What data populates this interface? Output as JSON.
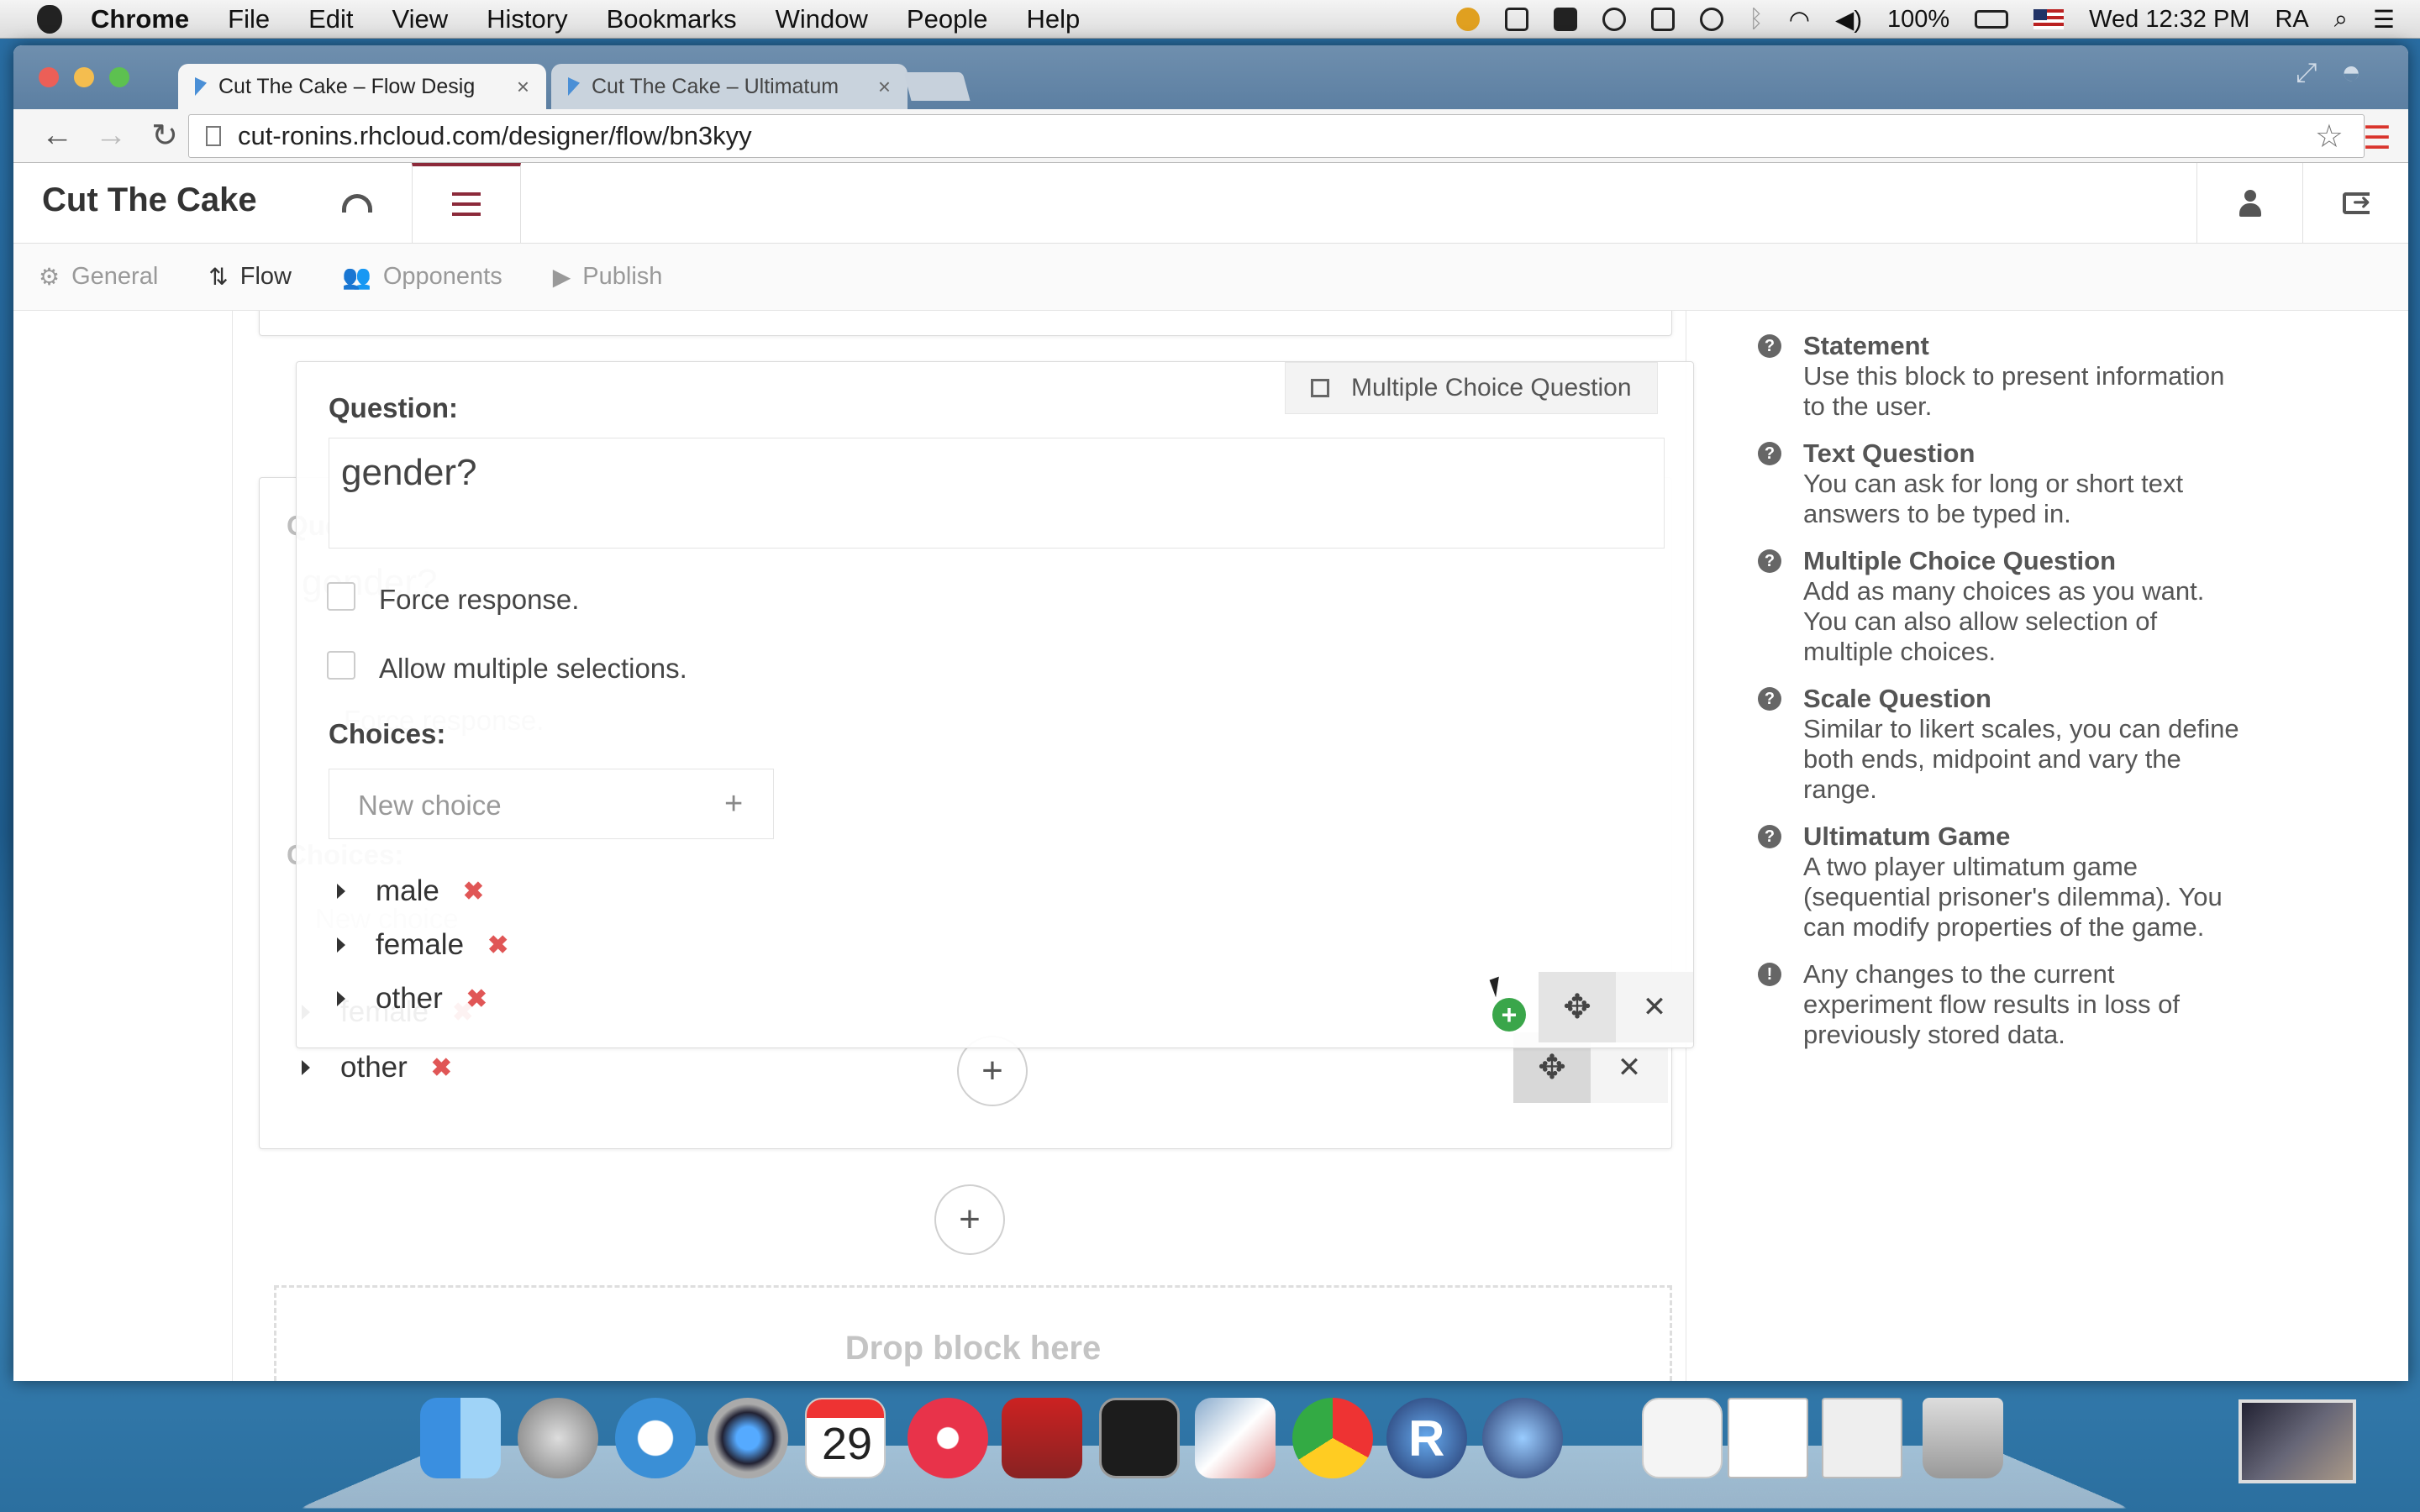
{
  "menubar": {
    "app": "Chrome",
    "items": [
      "File",
      "Edit",
      "View",
      "History",
      "Bookmarks",
      "Window",
      "People",
      "Help"
    ],
    "battery": "100%",
    "clock": "Wed 12:32 PM",
    "user": "RA"
  },
  "browser": {
    "tabs": [
      {
        "title": "Cut The Cake – Flow Desig",
        "close": "×"
      },
      {
        "title": "Cut The Cake – Ultimatum",
        "close": "×"
      }
    ],
    "url": "cut-ronins.rhcloud.com/designer/flow/bn3kyy"
  },
  "app": {
    "brand": "Cut The Cake",
    "subnav": [
      {
        "icon": "gears-icon",
        "label": "General"
      },
      {
        "icon": "sort-icon",
        "label": "Flow"
      },
      {
        "icon": "users-icon",
        "label": "Opponents"
      },
      {
        "icon": "play-icon",
        "label": "Publish"
      }
    ]
  },
  "block": {
    "type_label": "Multiple Choice Question",
    "question_label": "Question:",
    "question_value": "gender?",
    "force_response": "Force response.",
    "allow_multiple": "Allow multiple selections.",
    "choices_label": "Choices:",
    "new_choice_placeholder": "New choice",
    "choices": [
      "male",
      "female",
      "other"
    ]
  },
  "drop_zone": "Drop block here",
  "help": [
    {
      "title": "Statement",
      "desc": "Use this block to present information to the user."
    },
    {
      "title": "Text Question",
      "desc": "You can ask for long or short text answers to be typed in."
    },
    {
      "title": "Multiple Choice Question",
      "desc": "Add as many choices as you want. You can also allow selection of multiple choices."
    },
    {
      "title": "Scale Question",
      "desc": "Similar to likert scales, you can define both ends, midpoint and vary the range."
    },
    {
      "title": "Ultimatum Game",
      "desc": "A two player ultimatum game (sequential prisoner's dilemma). You can modify properties of the game."
    },
    {
      "title": "",
      "desc": "Any changes to the current experiment flow results in loss of previously stored data."
    }
  ],
  "dock": {
    "calendar_day": "29",
    "r_label": "R"
  },
  "colors": {
    "accent": "#8c2a3a",
    "delete": "#e05656",
    "drag_plus": "#3aa64a"
  }
}
